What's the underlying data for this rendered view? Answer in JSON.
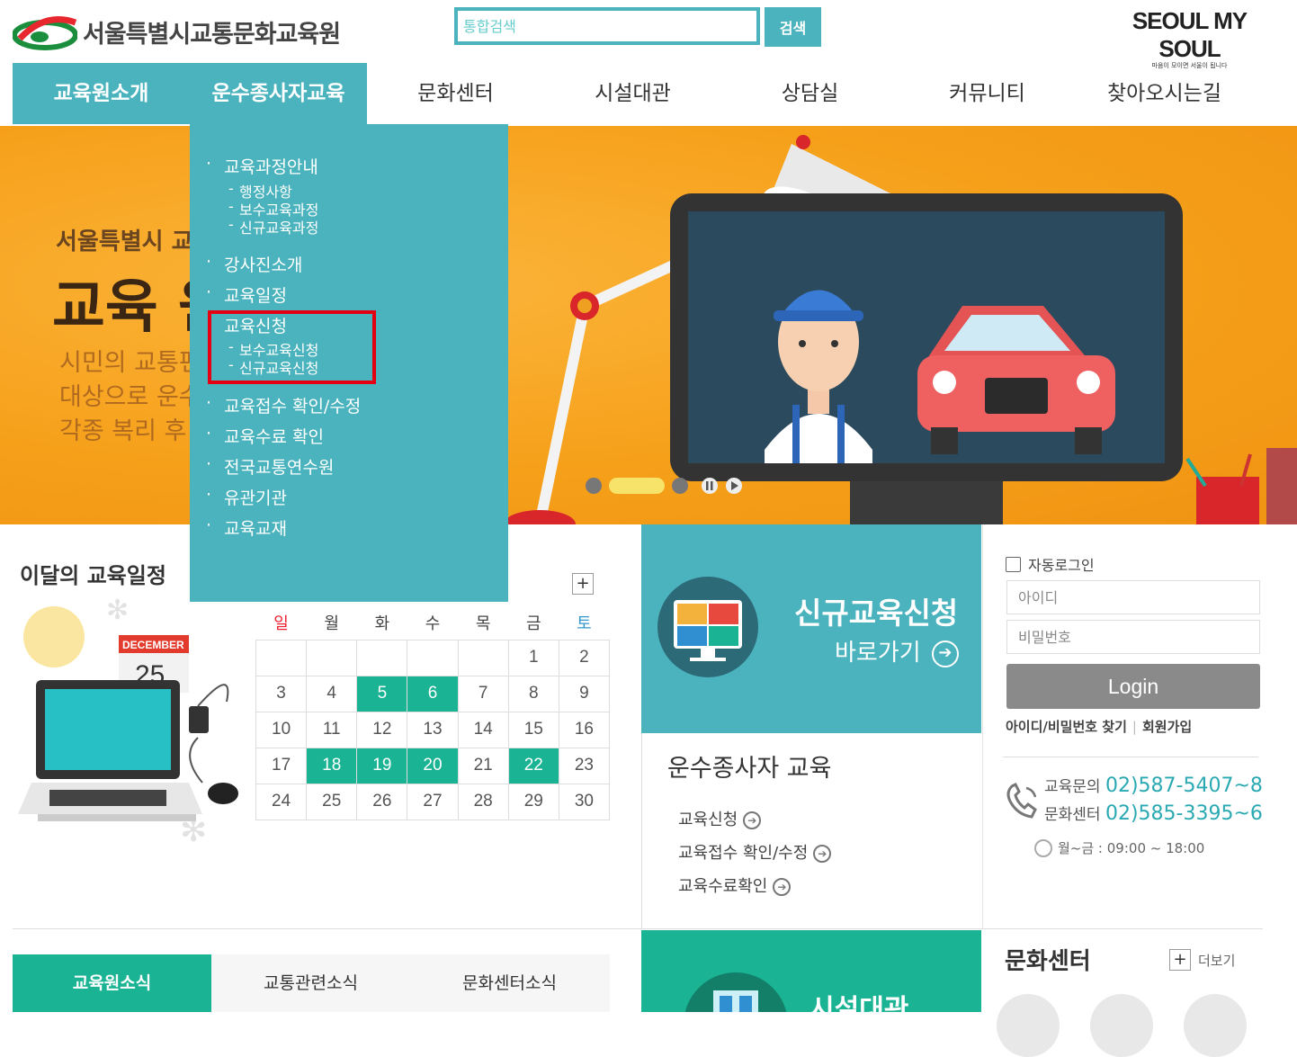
{
  "header": {
    "org_name": "서울특별시교통문화교육원",
    "search_placeholder": "통합검색",
    "search_button": "검색",
    "slogan_main": "SEOUL MY SOUL",
    "slogan_sub": "마음이 모이면 서울이 됩니다"
  },
  "gnb": {
    "items": [
      {
        "label": "교육원소개"
      },
      {
        "label": "운수종사자교육"
      },
      {
        "label": "문화센터"
      },
      {
        "label": "시설대관"
      },
      {
        "label": "상담실"
      },
      {
        "label": "커뮤니티"
      },
      {
        "label": "찾아오시는길"
      }
    ]
  },
  "hero": {
    "subtitle": "서울특별시 교",
    "title": "교육 원",
    "desc_line1": "시민의 교통편                          사자를",
    "desc_line2": "대상으로 운수                          육과",
    "desc_line3": "각종 복리 후"
  },
  "dropdown": {
    "items": [
      {
        "label": "교육과정안내"
      },
      {
        "label": "행정사항"
      },
      {
        "label": "보수교육과정"
      },
      {
        "label": "신규교육과정"
      },
      {
        "label": "강사진소개"
      },
      {
        "label": "교육일정"
      },
      {
        "label": "교육신청"
      },
      {
        "label": "보수교육신청"
      },
      {
        "label": "신규교육신청"
      },
      {
        "label": "교육접수 확인/수정"
      },
      {
        "label": "교육수료 확인"
      },
      {
        "label": "전국교통연수원"
      },
      {
        "label": "유관기관"
      },
      {
        "label": "교육교재"
      }
    ]
  },
  "calendar": {
    "heading": "이달의 교육일정",
    "month_badge": "DECEMBER",
    "day_badge": "25",
    "plus": "+",
    "weekdays": [
      "일",
      "월",
      "화",
      "수",
      "목",
      "금",
      "토"
    ],
    "weeks": [
      [
        "",
        "",
        "",
        "",
        "",
        "1",
        "2"
      ],
      [
        "3",
        "4",
        "5",
        "6",
        "7",
        "8",
        "9"
      ],
      [
        "10",
        "11",
        "12",
        "13",
        "14",
        "15",
        "16"
      ],
      [
        "17",
        "18",
        "19",
        "20",
        "21",
        "22",
        "23"
      ],
      [
        "24",
        "25",
        "26",
        "27",
        "28",
        "29",
        "30"
      ]
    ],
    "highlighted_days": [
      "5",
      "6",
      "18",
      "19",
      "20",
      "22"
    ]
  },
  "apply": {
    "title": "신규교육신청",
    "link": "바로가기"
  },
  "driver_edu": {
    "title": "운수종사자 교육",
    "links": [
      {
        "label": "교육신청"
      },
      {
        "label": "교육접수 확인/수정"
      },
      {
        "label": "교육수료확인"
      }
    ]
  },
  "login": {
    "autologin": "자동로그인",
    "id_placeholder": "아이디",
    "pw_placeholder": "비밀번호",
    "button": "Login",
    "find_link": "아이디/비밀번호 찾기",
    "join_link": "회원가입"
  },
  "contact": {
    "edu_label": "교육문의",
    "edu_number": "02)587-5407~8",
    "culture_label": "문화센터",
    "culture_number": "02)585-3395~6",
    "hours": "월~금 : 09:00 ~ 18:00"
  },
  "bottom": {
    "tabs": [
      {
        "label": "교육원소식"
      },
      {
        "label": "교통관련소식"
      },
      {
        "label": "문화센터소식"
      }
    ],
    "facility_label": "시설대관",
    "culture_title": "문화센터",
    "more": "더보기",
    "more_plus": "+"
  },
  "colors": {
    "teal": "#4ab3bd",
    "green": "#1ab394",
    "hero_orange": "#f7a51d",
    "highlight_red": "#e40012"
  }
}
